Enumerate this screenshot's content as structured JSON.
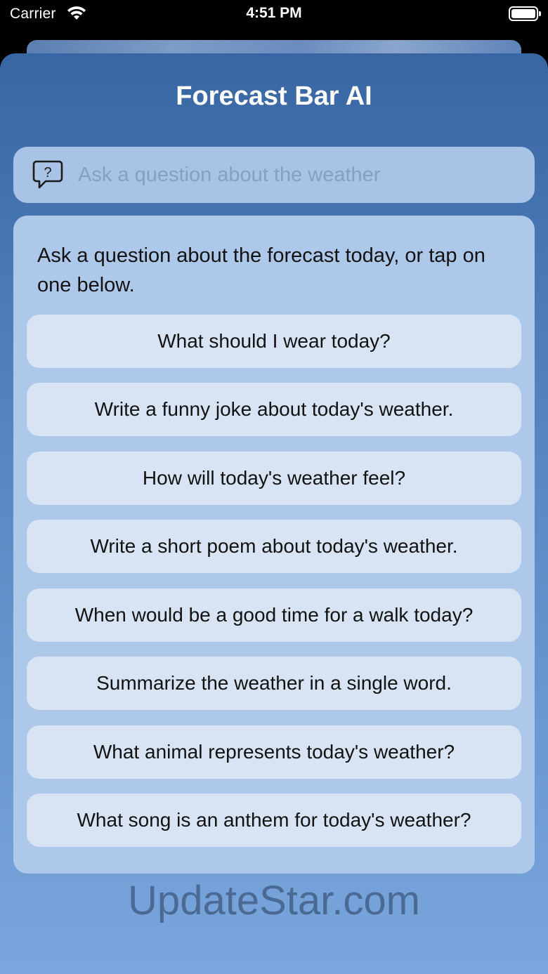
{
  "status_bar": {
    "carrier": "Carrier",
    "time": "4:51 PM"
  },
  "app": {
    "title": "Forecast Bar AI"
  },
  "search": {
    "placeholder": "Ask a question about the weather",
    "value": "",
    "icon": "question-bubble-icon"
  },
  "panel": {
    "intro": "Ask a question about the forecast today, or tap on one below.",
    "suggestions": [
      "What should I wear today?",
      "Write a funny joke about today's weather.",
      "How will today's weather feel?",
      "Write a short poem about today's weather.",
      "When would be a good time for a walk today?",
      "Summarize the weather in a single word.",
      "What animal represents today's weather?",
      "What song is an anthem for today's weather?"
    ]
  },
  "watermark": "UpdateStar.com",
  "colors": {
    "sheet_top": "#3766a3",
    "sheet_bottom": "#7aa6dd",
    "panel": "#aec8ea",
    "suggestion_button": "#d8e4f3"
  }
}
